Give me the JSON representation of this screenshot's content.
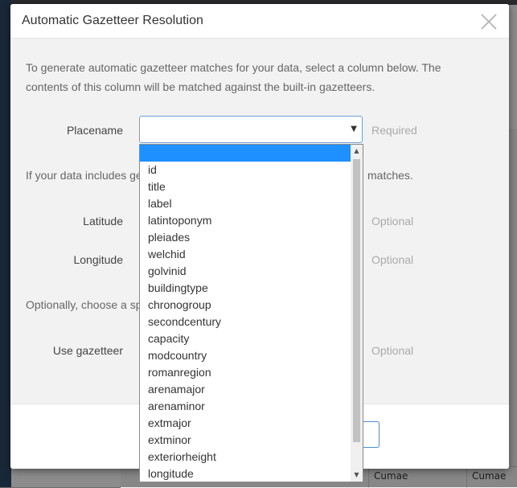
{
  "modal": {
    "title": "Automatic Gazetteer Resolution",
    "intro": "To generate automatic gazetteer matches for your data, select a column below. The contents of this column will be matched against the built-in gazetteers.",
    "placename_label": "Placename",
    "placename_hint": "Required",
    "geo_text_left": "If your data includes geo-",
    "geo_text_right": "matches.",
    "latitude_label": "Latitude",
    "latitude_hint": "Optional",
    "longitude_label": "Longitude",
    "longitude_hint": "Optional",
    "optional_text": "Optionally, choose a spec",
    "gazetteer_label": "Use gazetteer",
    "gazetteer_hint": "Optional"
  },
  "dropdown": {
    "selected_index": 0,
    "options": [
      "",
      "id",
      "title",
      "label",
      "latintoponym",
      "pleiades",
      "welchid",
      "golvinid",
      "buildingtype",
      "chronogroup",
      "secondcentury",
      "capacity",
      "modcountry",
      "romanregion",
      "arenamajor",
      "arenaminor",
      "extmajor",
      "extminor",
      "exteriorheight",
      "longitude"
    ]
  },
  "background": {
    "table_cells": [
      "Cumae",
      "Cumae"
    ]
  },
  "icons": {
    "close": "close-icon",
    "caret": "caret-down-icon"
  },
  "colors": {
    "selected_bg": "#1e90ff",
    "select_border": "#6ea0d8",
    "hint": "#aaaaaa"
  }
}
